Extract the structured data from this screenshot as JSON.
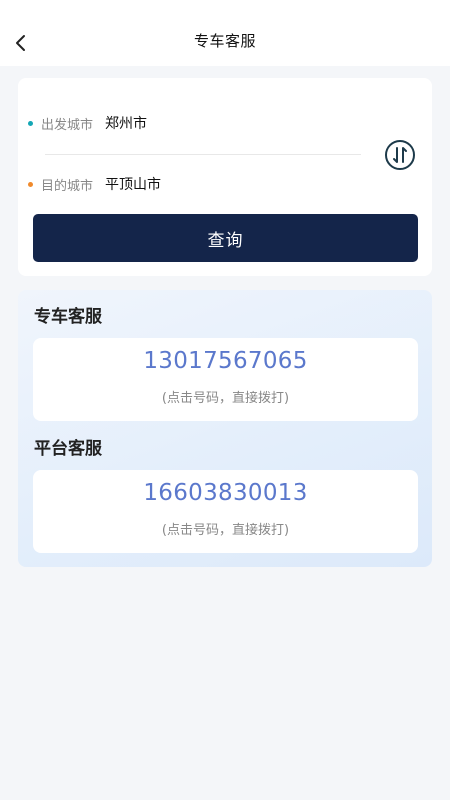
{
  "header": {
    "title": "专车客服",
    "back_icon": "chevron-left-icon"
  },
  "query": {
    "from_label": "出发城市",
    "from_value": "郑州市",
    "to_label": "目的城市",
    "to_value": "平顶山市",
    "swap_icon": "swap-arrows-icon",
    "button_label": "查询",
    "colors": {
      "from_dot": "#14a7b5",
      "to_dot": "#f08a2c",
      "button_bg": "#14254a"
    }
  },
  "services": [
    {
      "title": "专车客服",
      "phone": "13017567065",
      "hint": "(点击号码，直接拨打)"
    },
    {
      "title": "平台客服",
      "phone": "16603830013",
      "hint": "(点击号码，直接拨打)"
    }
  ],
  "colors": {
    "phone_text": "#5b78cc",
    "page_bg": "#f4f6f9"
  }
}
